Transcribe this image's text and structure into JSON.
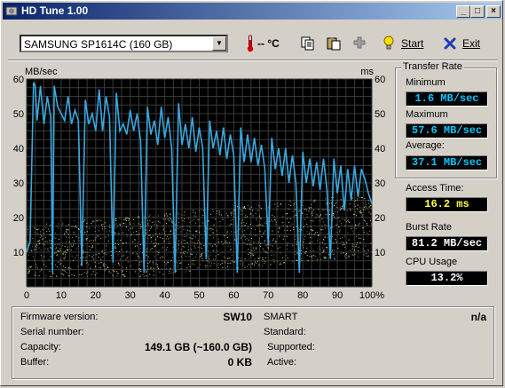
{
  "window": {
    "title": "HD Tune 1.00"
  },
  "toolbar": {
    "drive": "SAMSUNG SP1614C (160 GB)",
    "temperature": "-- °C",
    "start_label": "Start",
    "exit_label": "Exit"
  },
  "chart_data": {
    "type": "line",
    "ylabel_left": "MB/sec",
    "ylabel_right": "ms",
    "ylim": [
      0,
      60
    ],
    "y_ticks": [
      "0",
      "10",
      "20",
      "30",
      "40",
      "50",
      "60"
    ],
    "x_ticks": [
      "0",
      "10",
      "20",
      "30",
      "40",
      "50",
      "60",
      "70",
      "80",
      "90",
      "100%"
    ],
    "grid": true,
    "colors": {
      "background": "#000000",
      "grid": "#3a3a3a",
      "transfer_line": "#39a8e0",
      "access_points": "#e0d890"
    },
    "series": [
      {
        "points": [
          [
            0,
            10
          ],
          [
            1,
            13
          ],
          [
            2,
            59
          ],
          [
            2.5,
            58
          ],
          [
            3,
            48
          ],
          [
            4,
            58
          ],
          [
            5,
            47
          ],
          [
            6,
            55
          ],
          [
            7,
            49
          ],
          [
            7.5,
            4
          ],
          [
            8,
            58
          ],
          [
            9,
            52
          ],
          [
            10,
            50
          ],
          [
            11,
            48
          ],
          [
            12,
            55
          ],
          [
            13,
            47
          ],
          [
            14,
            51
          ],
          [
            15,
            48
          ],
          [
            16,
            6
          ],
          [
            17,
            54
          ],
          [
            18,
            47
          ],
          [
            19,
            50
          ],
          [
            20,
            45
          ],
          [
            21,
            57
          ],
          [
            22,
            45
          ],
          [
            23,
            55
          ],
          [
            24,
            49
          ],
          [
            25,
            7
          ],
          [
            26,
            56
          ],
          [
            27,
            45
          ],
          [
            28,
            47
          ],
          [
            29,
            44
          ],
          [
            30,
            51
          ],
          [
            31,
            45
          ],
          [
            32,
            50
          ],
          [
            33,
            42
          ],
          [
            34,
            4
          ],
          [
            35,
            52
          ],
          [
            36,
            44
          ],
          [
            37,
            48
          ],
          [
            38,
            41
          ],
          [
            39,
            52
          ],
          [
            40,
            43
          ],
          [
            41,
            49
          ],
          [
            42,
            40
          ],
          [
            43,
            4
          ],
          [
            44,
            53
          ],
          [
            45,
            41
          ],
          [
            46,
            47
          ],
          [
            47,
            40
          ],
          [
            48,
            49
          ],
          [
            49,
            39
          ],
          [
            50,
            46
          ],
          [
            51,
            40
          ],
          [
            52,
            8
          ],
          [
            53,
            48
          ],
          [
            54,
            40
          ],
          [
            55,
            45
          ],
          [
            56,
            38
          ],
          [
            57,
            46
          ],
          [
            58,
            37
          ],
          [
            59,
            44
          ],
          [
            60,
            38
          ],
          [
            61,
            4
          ],
          [
            62,
            46
          ],
          [
            63,
            36
          ],
          [
            64,
            44
          ],
          [
            65,
            36
          ],
          [
            66,
            43
          ],
          [
            67,
            35
          ],
          [
            68,
            41
          ],
          [
            69,
            34
          ],
          [
            70,
            12
          ],
          [
            71,
            43
          ],
          [
            72,
            34
          ],
          [
            73,
            40
          ],
          [
            74,
            32
          ],
          [
            75,
            40
          ],
          [
            76,
            30
          ],
          [
            77,
            38
          ],
          [
            78,
            30
          ],
          [
            79,
            4
          ],
          [
            80,
            39
          ],
          [
            81,
            30
          ],
          [
            82,
            37
          ],
          [
            83,
            29
          ],
          [
            84,
            36
          ],
          [
            85,
            28
          ],
          [
            86,
            37
          ],
          [
            87,
            28
          ],
          [
            88,
            8
          ],
          [
            89,
            37
          ],
          [
            90,
            27
          ],
          [
            91,
            35
          ],
          [
            92,
            22
          ],
          [
            93,
            34
          ],
          [
            94,
            25
          ],
          [
            95,
            35
          ],
          [
            96,
            26
          ],
          [
            97,
            34
          ],
          [
            98,
            31
          ],
          [
            99,
            27
          ],
          [
            100,
            24
          ]
        ]
      }
    ]
  },
  "stats": {
    "transfer_rate_title": "Transfer Rate",
    "minimum_label": "Minimum",
    "minimum_value": "1.6 MB/sec",
    "maximum_label": "Maximum",
    "maximum_value": "57.6 MB/sec",
    "average_label": "Average:",
    "average_value": "37.1 MB/sec",
    "access_time_label": "Access Time:",
    "access_time_value": "16.2 ms",
    "burst_rate_label": "Burst Rate",
    "burst_rate_value": "81.2 MB/sec",
    "cpu_usage_label": "CPU Usage",
    "cpu_usage_value": "13.2%",
    "colors": {
      "cyan": "#00c8ff",
      "yellow": "#ffff40",
      "white": "#ffffff"
    }
  },
  "info": {
    "firmware_label": "Firmware version:",
    "firmware_value": "SW10",
    "serial_label": "Serial number:",
    "serial_value": "",
    "capacity_label": "Capacity:",
    "capacity_value": "149.1 GB (~160.0 GB)",
    "buffer_label": "Buffer:",
    "buffer_value": "0 KB",
    "smart_label": "SMART",
    "smart_value": "n/a",
    "standard_label": "Standard:",
    "supported_label": "Supported:",
    "active_label": "Active:"
  }
}
